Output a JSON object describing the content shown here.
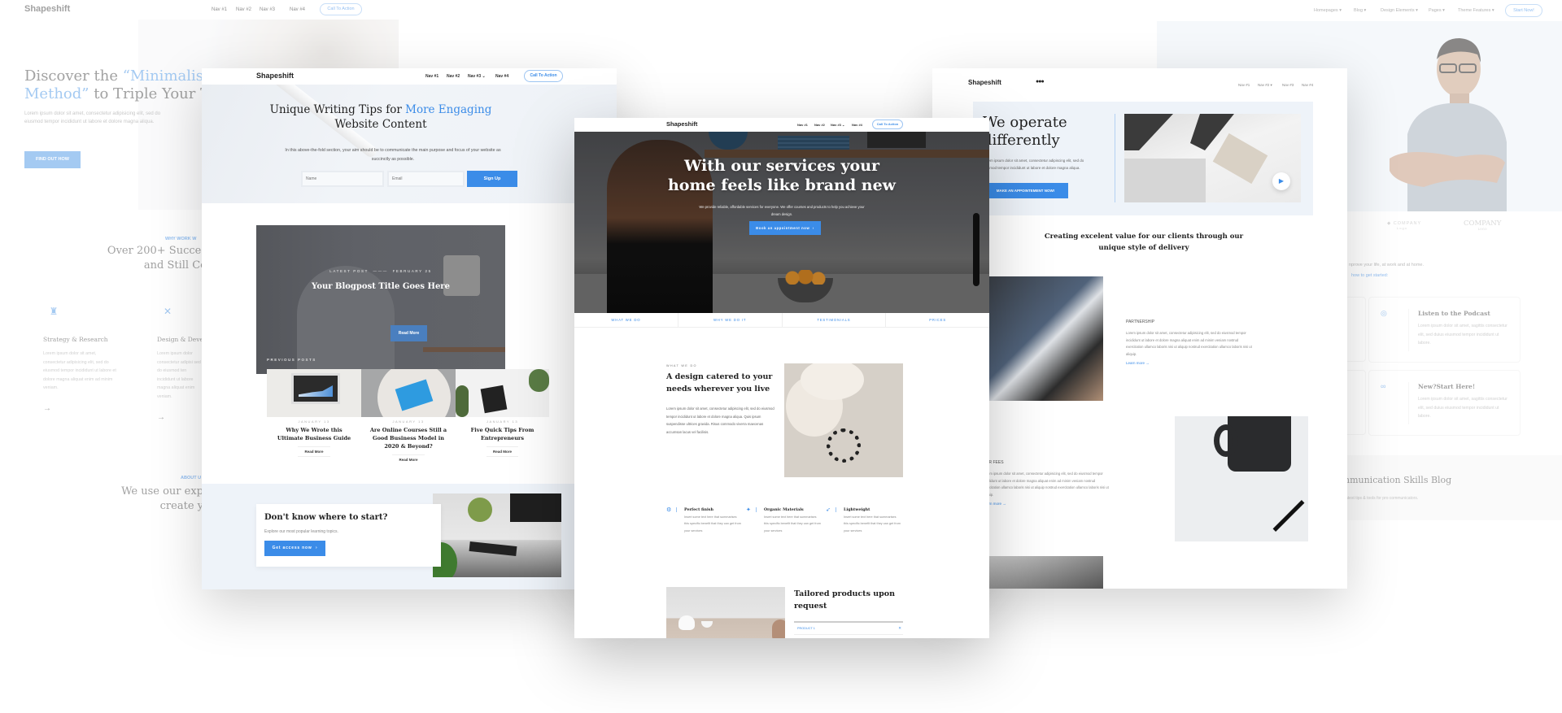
{
  "brand": "Shapeshift",
  "colors": {
    "accent": "#3b8ce8",
    "light_bg": "#eef3f9"
  },
  "back_left": {
    "nav": [
      "Nav #1",
      "Nav #2",
      "Nav #3",
      "Nav #4"
    ],
    "cta": "Call To Action",
    "hero_title_a": "Discover the ",
    "hero_title_b": "“Minimalist",
    "hero_title_c": "Method”",
    "hero_title_d": " to Triple Your Tra",
    "hero_text": "Lorem ipsum dolor sit amet, consectetur adipisicing elit, sed do eiusmod tempor incididunt ut labore et dolore magna aliqua.",
    "hero_button": "FIND OUT HOW",
    "why_label": "WHY WORK W",
    "why_title_1": "Over 200+ Succes",
    "why_title_2": "and Still Co",
    "features": [
      {
        "icon": "chess-rook-icon",
        "title": "Strategy & Research",
        "text": "Lorem ipsum dolor sit amet, consectetur adipisicing elit, sed do eiusmod tempor incididunt ut labore et dolore magna aliquat enim ad minim veniam."
      },
      {
        "icon": "tools-icon",
        "title": "Design & Devel",
        "text": "Lorem ipsum dolor consectetur adipisi sed do eiusmod ten incididunt ut labore magna aliquat enim veniam."
      }
    ],
    "about_label": "ABOUT U",
    "about_title_1": "We use our exp",
    "about_title_2": "create y"
  },
  "back_right": {
    "nav": [
      "Homepages",
      "Blog",
      "Design Elements",
      "Pages",
      "Theme Features"
    ],
    "cta": "Start Now!",
    "logos": [
      "COMPANY",
      "COMPANY"
    ],
    "logo_sub": [
      "Logo",
      "LOGO"
    ],
    "text": "nprove your life, at work and at home.",
    "link": "how to get started:",
    "cards": [
      {
        "icon": "podcast-icon",
        "title": "Listen to the Podcast",
        "text": "Lorem ipsum dolor sit amet, sagittis consectetur elit, sed duius eiusmod tempor incididunt ut labore."
      },
      {
        "icon": "binoculars-icon",
        "title": "New?Start Here!",
        "text": "Lorem ipsum dolor sit amet, sagittis consectetur elit, sed duius eiusmod tempor incididunt ut labore."
      }
    ],
    "blog_title": "nmunication Skills Blog",
    "blog_sub": "atest tips & tools for pro communicators."
  },
  "writing": {
    "nav": [
      "Nav #1",
      "Nav #2",
      "Nav #3",
      "Nav #4"
    ],
    "cta": "Call To Action",
    "title_a": "Unique Writing Tips for ",
    "title_b": "More Engaging",
    "title_c": "Website Content",
    "text": "In this above-the-fold section, your aim should be to communicate the main purpose and focus of your website as succinctly as possible.",
    "name_placeholder": "Name",
    "email_placeholder": "Email",
    "signup": "Sign Up",
    "latest_label": "LATEST POST",
    "latest_date": "FEBRUARY 25",
    "latest_title": "Your Blogpost Title Goes Here",
    "read_more": "Read More",
    "previous_label": "PREVIOUS POSTS",
    "posts": [
      {
        "date": "JANUARY 13",
        "title": "Why We Wrote this Ultimate Business Guide",
        "read": "Read More"
      },
      {
        "date": "JANUARY 13",
        "title": "Are Online Courses Still a Good Business Model in 2020 & Beyond?",
        "read": "Read More"
      },
      {
        "date": "JANUARY 13",
        "title": "Five Quick Tips From Entrepreneurs",
        "read": "Read More"
      }
    ],
    "cta_title": "Don't know where to start?",
    "cta_text": "Explore our most popular learning topics.",
    "cta_button": "Get access now"
  },
  "home": {
    "nav": [
      "Nav #1",
      "Nav #2",
      "Nav #3",
      "Nav #4"
    ],
    "cta": "Call To Action",
    "hero_title_1": "With our services your",
    "hero_title_2": "home feels like brand new",
    "hero_text": "We provide reliable, affordable services for everyone. We offer courses and products to help you achieve your dream design.",
    "hero_button": "Book an appointment now",
    "tabs": [
      "WHAT WE DO",
      "WHY WE DO IT",
      "TESTIMONIALS",
      "PRICES"
    ],
    "section_label": "WHAT WE DO",
    "section_title": "A design catered to your needs wherever you live",
    "section_text": "Lorem ipsum dolor sit amet, consectetur adipiscing elit, sed do eiusmod tempor incididunt ut labore et dolore magna aliqua. Quis ipsum suspendisse ultrices gravida. Risus commodo viverra maecenas accumsan lacus vel facilisis.",
    "features": [
      {
        "icon": "gear-icon",
        "title": "Perfect finish",
        "text": "Insert some text here that summarises this specific benefit that they can get from your services"
      },
      {
        "icon": "sparkle-icon",
        "title": "Organic Materials",
        "text": "Insert some text here that summarises this specific benefit that they can get from your services"
      },
      {
        "icon": "feather-icon",
        "title": "Lightweight",
        "text": "Insert some text here that summarises this specific benefit that they can get from your services"
      }
    ],
    "tailored_title": "Tailored products upon request",
    "product_1": "PRODUCT 1"
  },
  "operate": {
    "nav": [
      "Nav #1",
      "Nav #2",
      "Nav #3",
      "Nav #4"
    ],
    "hero_title_1": "We operate",
    "hero_title_2": "differently",
    "hero_text": "Lorem ipsum dolor sit amet, consectetur adipiscing elit, sed do eiusmod tempor incididunt ut labore et dolore magna aliqua.",
    "hero_button": "MAKE AN APPOINTEMENT NOW!",
    "value_title": "Creating excelent value for our clients through our unique style of delivery",
    "rows": [
      {
        "label": "PARTNERSHIP",
        "text": "Lorem ipsum dolor sit amet, consectetur adipisicing elit, sed do eiusmod tempor incididunt ut labore et dolore magna aliquat enim ad minim veniam nostrud exercitation ullamco laboris nisi ut aliquip nostrud exercitation ullamco laboris nisi ut aliquip.",
        "link": "Learn more"
      },
      {
        "label": "FAIR FEES",
        "text": "Lorem ipsum dolor sit amet, consectetur adipisicing elit, sed do eiusmod tempor incididunt ut labore et dolore magna aliquat enim ad minim veniam nostrud exercitation ullamco laboris nisi ut aliquip nostrud exercitation ullamco laboris nisi ut aliquip.",
        "link": "Learn more"
      }
    ]
  }
}
